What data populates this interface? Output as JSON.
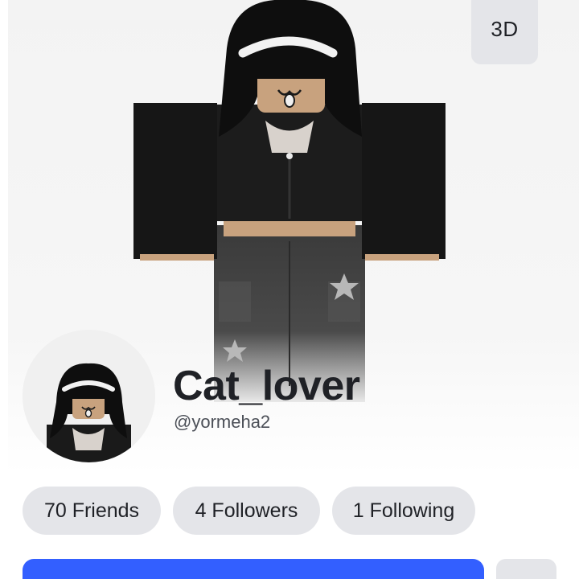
{
  "hero": {
    "view_toggle_label": "3D"
  },
  "profile": {
    "display_name": "Cat_lover",
    "username": "@yormeha2"
  },
  "stats": {
    "friends": "70 Friends",
    "followers": "4 Followers",
    "following": "1 Following"
  },
  "colors": {
    "primary_button": "#335fff",
    "pill_background": "#e4e5e9",
    "text": "#1f2126"
  }
}
